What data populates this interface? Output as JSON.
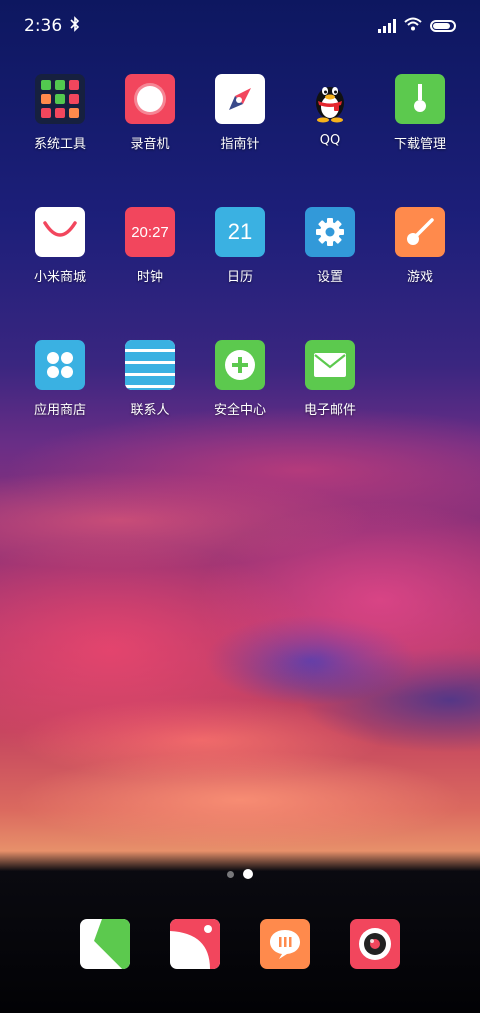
{
  "status_bar": {
    "time": "2:36",
    "icons": [
      "bluetooth-icon",
      "cellular-signal-icon",
      "wifi-icon",
      "battery-icon"
    ],
    "battery_level": 0.85
  },
  "home": {
    "rows": [
      [
        {
          "label": "系统工具",
          "icon": "folder-icon",
          "color": "#16203f"
        },
        {
          "label": "录音机",
          "icon": "recorder-icon",
          "color": "#f2465d"
        },
        {
          "label": "指南针",
          "icon": "compass-icon",
          "color": "#ffffff"
        },
        {
          "label": "QQ",
          "icon": "qq-penguin-icon",
          "color": ""
        },
        {
          "label": "下载管理",
          "icon": "download-icon",
          "color": "#5cc94e"
        }
      ],
      [
        {
          "label": "小米商城",
          "icon": "mi-store-icon",
          "color": "#ffffff"
        },
        {
          "label": "时钟",
          "icon": "clock-icon",
          "color": "#f2465d",
          "text": "20:27"
        },
        {
          "label": "日历",
          "icon": "calendar-icon",
          "color": "#3ab1e2",
          "text": "21"
        },
        {
          "label": "设置",
          "icon": "gear-icon",
          "color": "#3299d9"
        },
        {
          "label": "游戏",
          "icon": "game-icon",
          "color": "#ff8a4c"
        }
      ],
      [
        {
          "label": "应用商店",
          "icon": "app-store-icon",
          "color": "#3ab1e2"
        },
        {
          "label": "联系人",
          "icon": "contacts-icon",
          "color": "#3ab1e2"
        },
        {
          "label": "安全中心",
          "icon": "security-plus-icon",
          "color": "#5cc94e"
        },
        {
          "label": "电子邮件",
          "icon": "mail-icon",
          "color": "#5cc94e"
        }
      ]
    ]
  },
  "page_indicator": {
    "count": 2,
    "active": 2
  },
  "dock": [
    {
      "icon": "phone-icon",
      "color": "#ffffff"
    },
    {
      "icon": "browser-icon",
      "color": "#ffffff"
    },
    {
      "icon": "messages-icon",
      "color": "#ff8a4c"
    },
    {
      "icon": "camera-icon",
      "color": "#f2465d"
    }
  ],
  "folder_preview_colors": [
    "#52c94f",
    "#52c94f",
    "#f2465d",
    "#ff8a4c",
    "#52c94f",
    "#f2465d",
    "#f2465d",
    "#f2465d",
    "#ff8a4c"
  ]
}
